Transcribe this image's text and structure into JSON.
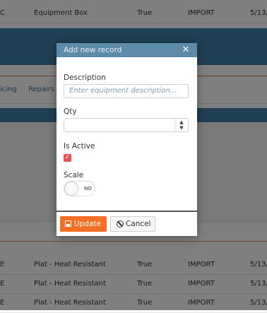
{
  "background": {
    "rows_top": [
      {
        "c0": "C",
        "c1": "Equipment Box",
        "c2": "True",
        "c3": "IMPORT",
        "c4": "5/13/"
      }
    ],
    "tabs": [
      {
        "label": "icing"
      },
      {
        "label": "Repairs"
      }
    ],
    "rows_bottom": [
      {
        "c0": "E",
        "c1": "Plat - Heat Resistant",
        "c2": "True",
        "c3": "IMPORT",
        "c4": "5/13/"
      },
      {
        "c0": "E",
        "c1": "Plat - Heat Resistant",
        "c2": "True",
        "c3": "IMPORT",
        "c4": "5/13/"
      },
      {
        "c0": "E",
        "c1": "Plat - Heat Resistant",
        "c2": "True",
        "c3": "IMPORT",
        "c4": "5/13/"
      }
    ]
  },
  "dialog": {
    "title": "Add new record",
    "close_glyph": "✕",
    "description_label": "Description",
    "description_placeholder": "Enter equipment description...",
    "qty_label": "Qty",
    "qty_value": "",
    "spin_up": "▲",
    "spin_down": "▼",
    "is_active_label": "Is Active",
    "is_active_checked": true,
    "check_glyph": "✓",
    "scale_label": "Scale",
    "scale_toggle_text": "NO",
    "update_label": "Update",
    "cancel_label": "Cancel"
  },
  "colors": {
    "accent_orange": "#f56e21",
    "title_bar": "#5d8cab",
    "header_blue": "#3e7fa8",
    "checkbox_red": "#e9534f"
  },
  "icons": {
    "close": "close-icon",
    "save": "save-icon",
    "cancel": "cancel-icon"
  }
}
